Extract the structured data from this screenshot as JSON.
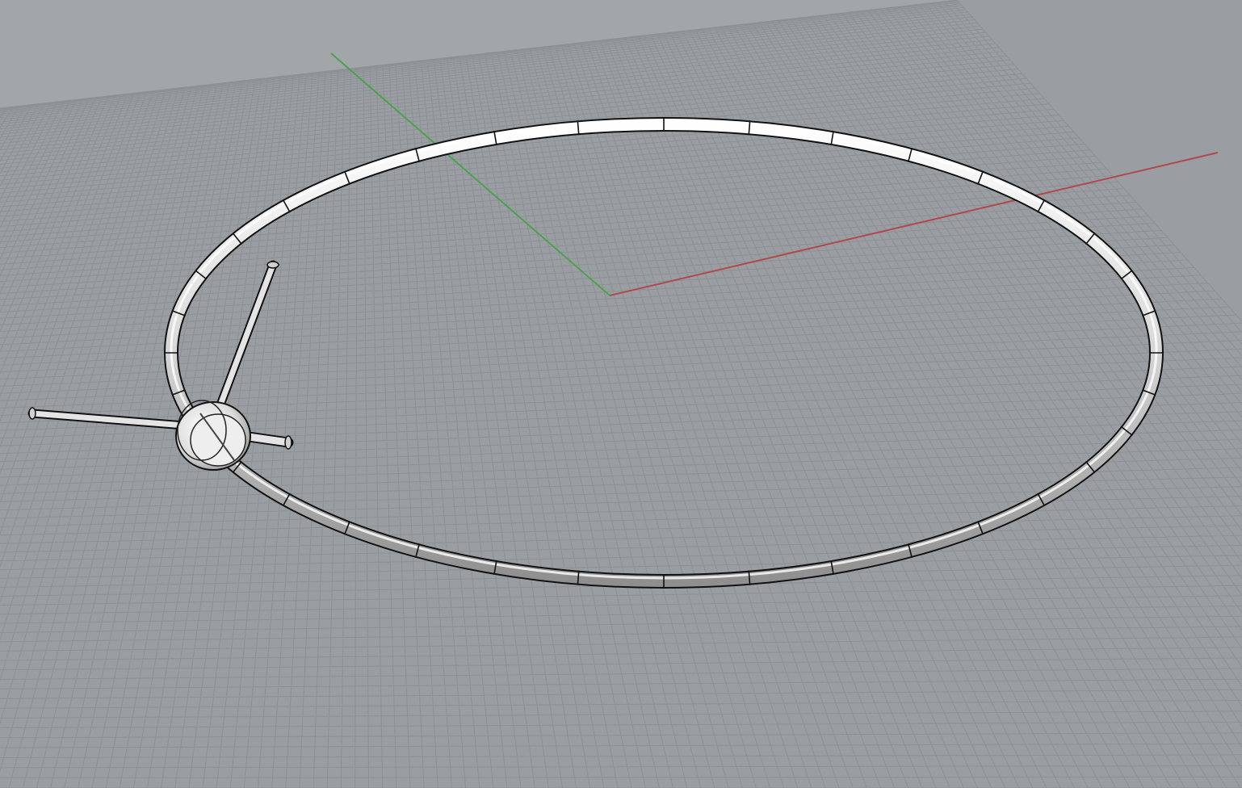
{
  "viewport": {
    "view": "perspective",
    "display_mode": "shaded",
    "background_color": "#a3a6a9",
    "grid_plane_color": "#9a9ea2",
    "grid_line_color": "#8c9196",
    "grid_visible": true
  },
  "axes": {
    "x_axis_color": "#b0494b",
    "y_axis_color": "#4ca14c"
  },
  "model": {
    "ring_color": "#f2f2f2",
    "ring_outline_color": "#111111",
    "hub_color": "#e6e6e6",
    "spoke_count": 3,
    "ring_segment_count": 36
  }
}
